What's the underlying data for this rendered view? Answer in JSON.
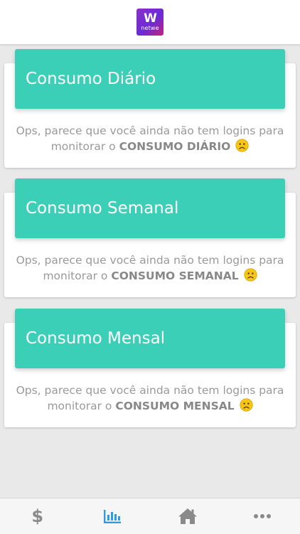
{
  "app": {
    "logo_mark": "W",
    "logo_word": "netwe"
  },
  "cards": [
    {
      "title": "Consumo Diário",
      "message_prefix": "Ops, parece que você ainda não tem logins para monitorar o ",
      "message_strong": "CONSUMO DIÁRIO"
    },
    {
      "title": "Consumo Semanal",
      "message_prefix": "Ops, parece que você ainda não tem logins para monitorar o ",
      "message_strong": "CONSUMO SEMANAL"
    },
    {
      "title": "Consumo Mensal",
      "message_prefix": "Ops, parece que você ainda não tem logins para monitorar o ",
      "message_strong": "CONSUMO MENSAL"
    }
  ],
  "tabbar": {
    "dollar_glyph": "$",
    "active_tab": "consumption",
    "active_color": "#2f9be0",
    "inactive_color": "#8a8a8a",
    "icons": [
      "dollar-icon",
      "bar-chart-icon",
      "home-icon",
      "more-icon"
    ]
  },
  "colors": {
    "header_teal": "#3ccfb8",
    "emoji_yellow": "#f5c518"
  }
}
